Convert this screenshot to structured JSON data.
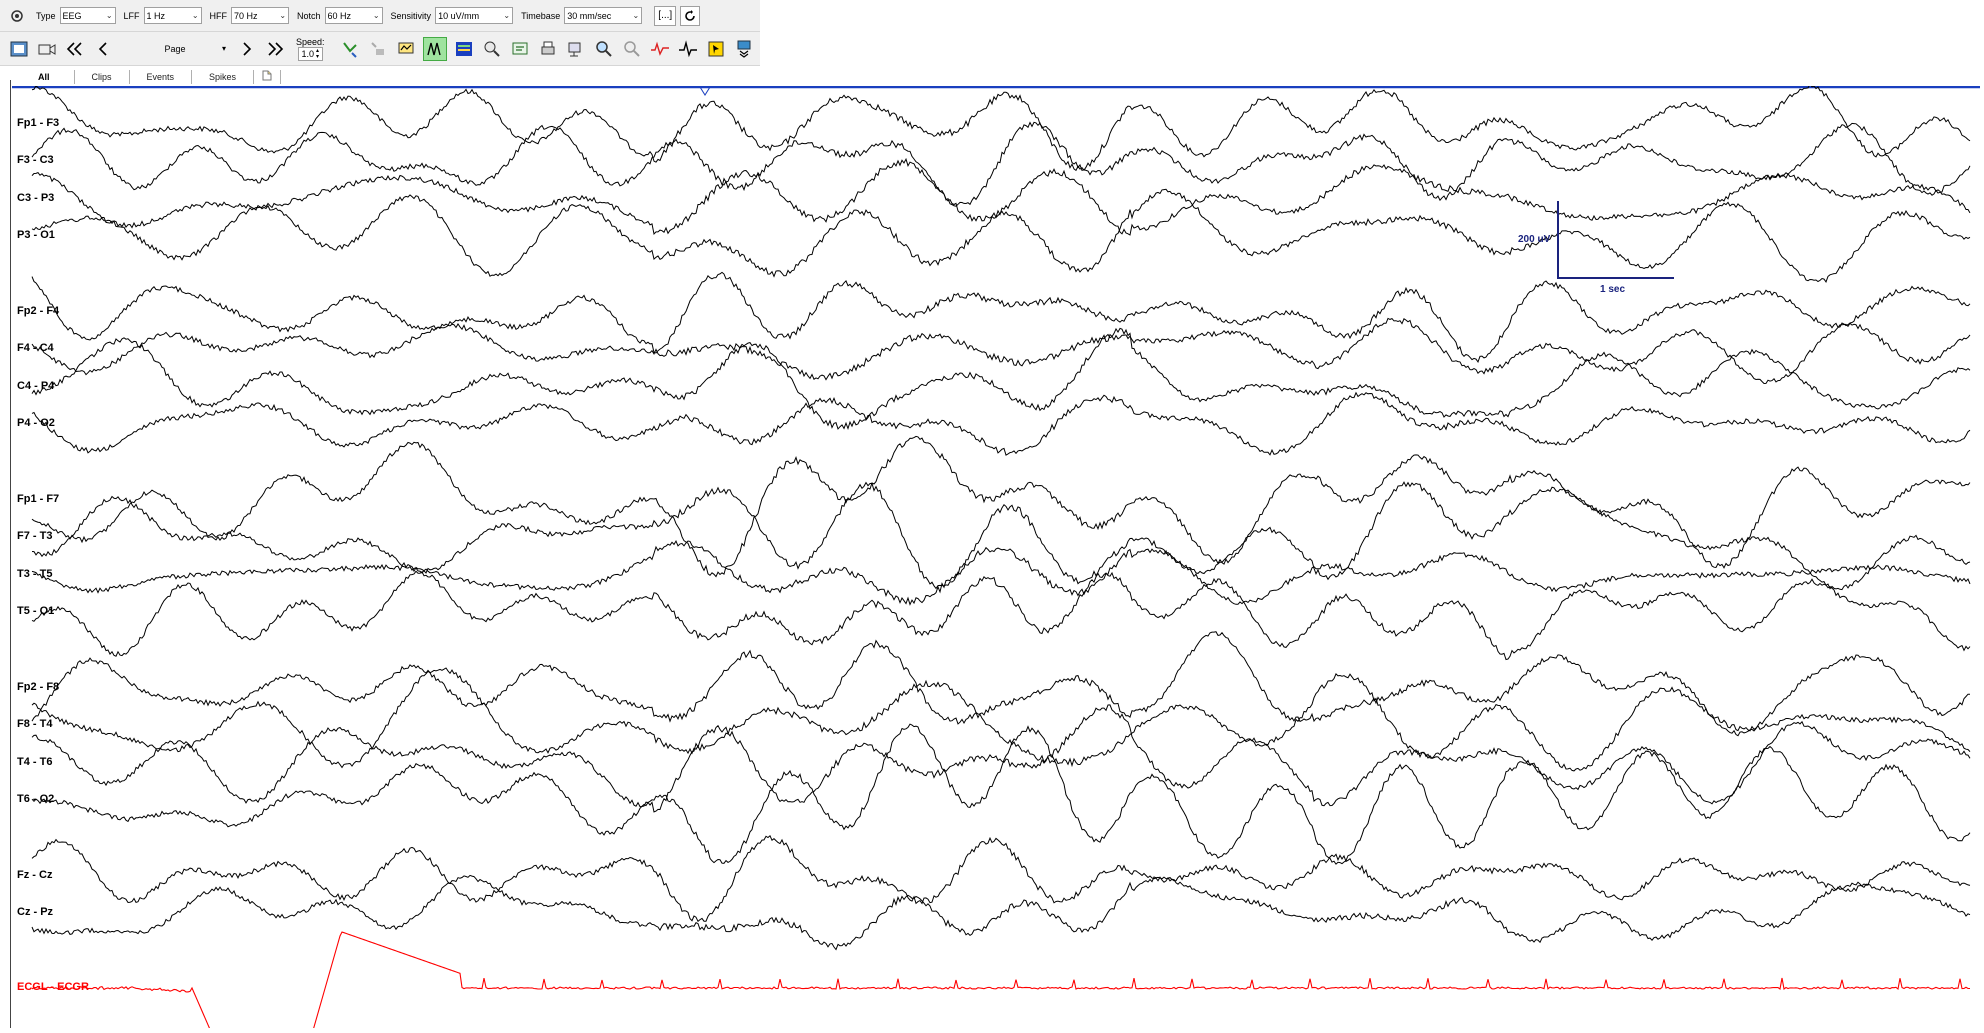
{
  "toolbar": {
    "type_label": "Type",
    "type_value": "EEG",
    "lff_label": "LFF",
    "lff_value": "1 Hz",
    "hff_label": "HFF",
    "hff_value": "70 Hz",
    "notch_label": "Notch",
    "notch_value": "60 Hz",
    "sensitivity_label": "Sensitivity",
    "sensitivity_value": "10 uV/mm",
    "timebase_label": "Timebase",
    "timebase_value": "30 mm/sec",
    "bracket_button": "[...]"
  },
  "nav": {
    "page_label": "Page",
    "speed_label": "Speed:",
    "speed_value": "1.0"
  },
  "tabs": [
    {
      "label": "All",
      "active": true
    },
    {
      "label": "Clips",
      "active": false
    },
    {
      "label": "Events",
      "active": false
    },
    {
      "label": "Spikes",
      "active": false
    }
  ],
  "channels": [
    {
      "label": "Fp1 - F3"
    },
    {
      "label": "F3 - C3"
    },
    {
      "label": "C3 - P3"
    },
    {
      "label": "P3 - O1"
    },
    {
      "label": "Fp2 - F4"
    },
    {
      "label": "F4 - C4"
    },
    {
      "label": "C4 - P4"
    },
    {
      "label": "P4 - O2"
    },
    {
      "label": "Fp1 - F7"
    },
    {
      "label": "F7 - T3"
    },
    {
      "label": "T3 - T5"
    },
    {
      "label": "T5 - O1"
    },
    {
      "label": "Fp2 - F8"
    },
    {
      "label": "F8 - T4"
    },
    {
      "label": "T4 - T6"
    },
    {
      "label": "T6 - O2"
    },
    {
      "label": "Fz - Cz"
    },
    {
      "label": "Cz - Pz"
    },
    {
      "label": "ECGL - ECGR"
    }
  ],
  "calibration": {
    "amplitude_label": "200 uV",
    "time_label": "1 sec"
  },
  "colors": {
    "trace": "#000000",
    "ecg_trace": "#ff0000",
    "page_marker": "#1a3fbf",
    "scale_bar": "#1a237e"
  }
}
